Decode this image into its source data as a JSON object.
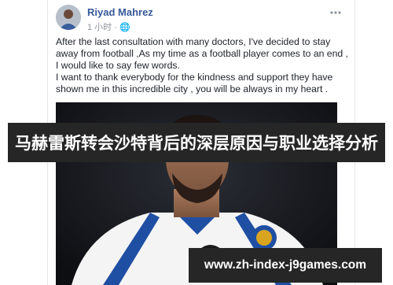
{
  "post": {
    "author": "Riyad Mahrez",
    "time": "1 小时 · 🌐",
    "more_icon": "more-horizontal-icon",
    "lines": [
      "After the last consultation with many doctors, I've decided to stay",
      "away from football ,As my time as a football player comes to an end ,",
      "I would like to say few words.",
      "I want to thank everybody for the kindness and support they have",
      "shown me in this incredible city , you will be always in my heart ."
    ]
  },
  "overlay": {
    "title": "马赫雷斯转会沙特背后的深层原因与职业选择分析",
    "url": "www.zh-index-j9games.com"
  },
  "colors": {
    "author": "#365899",
    "banner": "#262626",
    "jersey": "#ffffff",
    "jersey_trim": "#1f4fa3"
  }
}
